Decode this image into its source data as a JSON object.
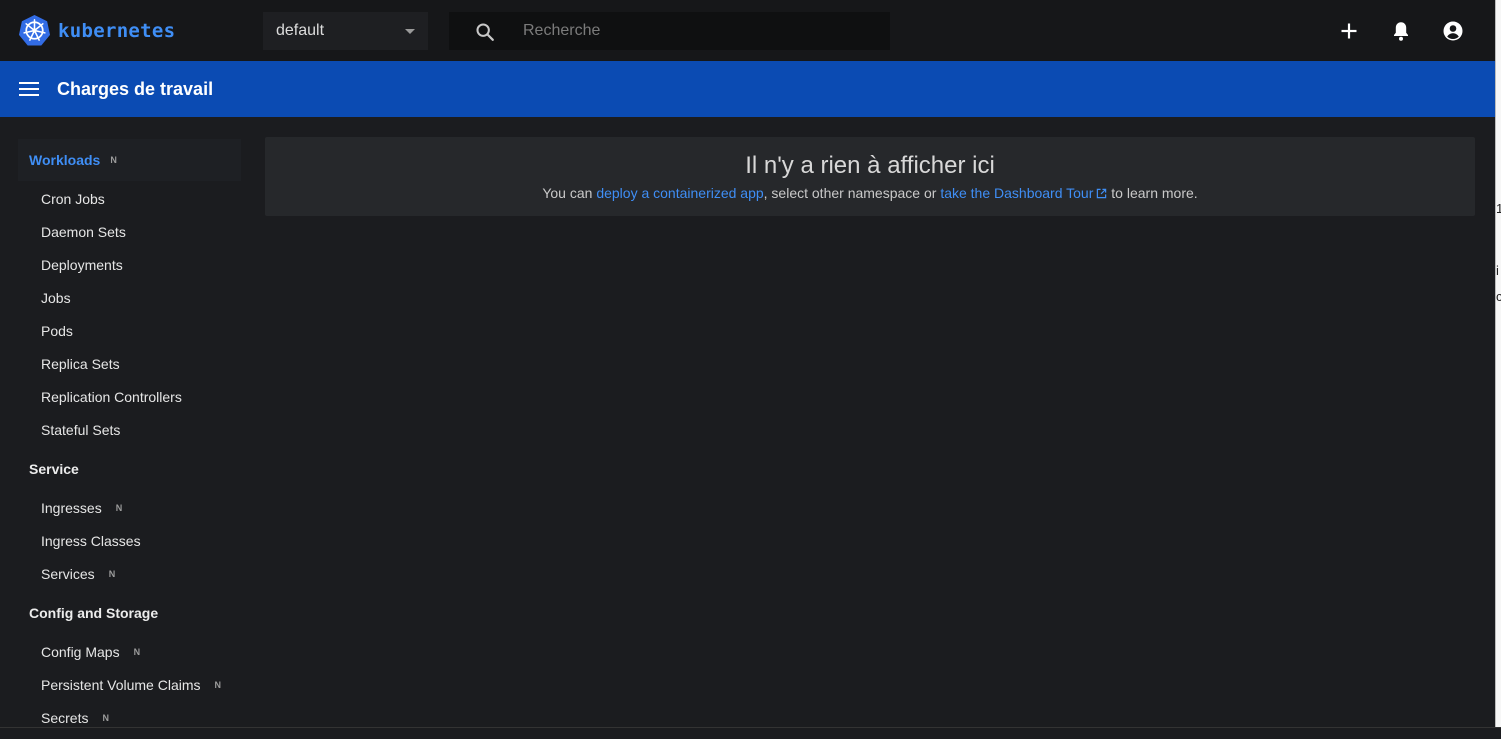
{
  "brand": {
    "name": "kubernetes"
  },
  "namespace": {
    "value": "default"
  },
  "search": {
    "placeholder": "Recherche"
  },
  "toolbar": {
    "title": "Charges de travail"
  },
  "sidebar": {
    "groups": [
      {
        "label": "Workloads",
        "badge": "N",
        "active": true,
        "items": [
          {
            "label": "Cron Jobs"
          },
          {
            "label": "Daemon Sets"
          },
          {
            "label": "Deployments"
          },
          {
            "label": "Jobs"
          },
          {
            "label": "Pods"
          },
          {
            "label": "Replica Sets"
          },
          {
            "label": "Replication Controllers"
          },
          {
            "label": "Stateful Sets"
          }
        ]
      },
      {
        "label": "Service",
        "items": [
          {
            "label": "Ingresses",
            "badge": "N"
          },
          {
            "label": "Ingress Classes"
          },
          {
            "label": "Services",
            "badge": "N"
          }
        ]
      },
      {
        "label": "Config and Storage",
        "items": [
          {
            "label": "Config Maps",
            "badge": "N"
          },
          {
            "label": "Persistent Volume Claims",
            "badge": "N"
          },
          {
            "label": "Secrets",
            "badge": "N"
          }
        ]
      }
    ]
  },
  "empty_state": {
    "title": "Il n'y a rien à afficher ici",
    "text_before": "You can ",
    "link_deploy": "deploy a containerized app",
    "text_middle": ", select other namespace or ",
    "link_tour": "take the Dashboard Tour",
    "text_after": " to learn more."
  },
  "edge_fragments": [
    "1",
    "i",
    "c"
  ],
  "colors": {
    "accent": "#3f8ef5",
    "toolbar": "#0b4bb3",
    "topbar": "#161719",
    "background": "#1b1c1f"
  },
  "icons": {
    "logo": "kubernetes-helm-logo",
    "search": "search-icon",
    "add": "plus-icon",
    "notifications": "bell-icon",
    "account": "account-circle-icon",
    "menu": "hamburger-menu-icon",
    "external": "open-in-new-icon"
  }
}
